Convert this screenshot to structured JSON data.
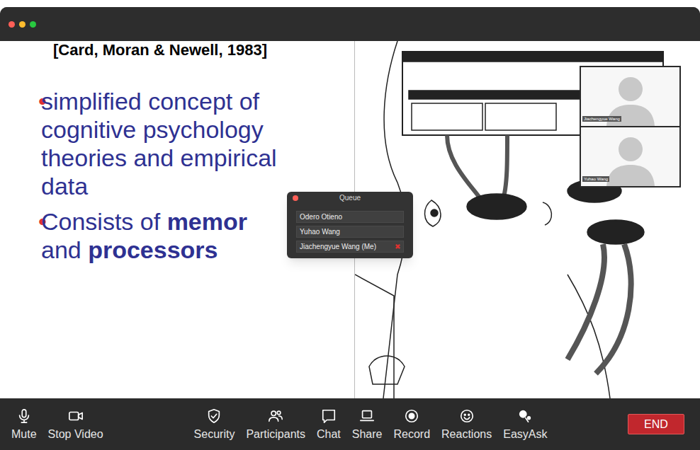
{
  "slide": {
    "title": "[Card, Moran & Newell, 1983]",
    "marker": "•",
    "bullets": [
      {
        "lines": [
          [
            {
              "text": "simplified concept of",
              "bold": false
            }
          ],
          [
            {
              "text": "cognitive psychology",
              "bold": false
            }
          ],
          [
            {
              "text": "theories and empirical",
              "bold": false
            }
          ],
          [
            {
              "text": "data",
              "bold": false
            }
          ]
        ]
      },
      {
        "lines": [
          [
            {
              "text": "Consists of ",
              "bold": false
            },
            {
              "text": "memor",
              "bold": true
            }
          ],
          [
            {
              "text": "and ",
              "bold": false
            },
            {
              "text": "processors",
              "bold": true
            }
          ]
        ]
      }
    ]
  },
  "video_tiles": [
    {
      "name": "Jiachengyue Wang"
    },
    {
      "name": "Yuhao Wang"
    }
  ],
  "queue": {
    "title": "Queue",
    "remove_icon": "✖",
    "entries": [
      {
        "name": "Odero Otieno",
        "me": false
      },
      {
        "name": "Yuhao Wang",
        "me": false
      },
      {
        "name": "Jiachengyue Wang (Me)",
        "me": true
      }
    ]
  },
  "toolbar": {
    "left": [
      "Mute",
      "Stop Video"
    ],
    "center": [
      "Security",
      "Participants",
      "Chat",
      "Share",
      "Record",
      "Reactions",
      "EasyAsk"
    ],
    "end": "END"
  }
}
